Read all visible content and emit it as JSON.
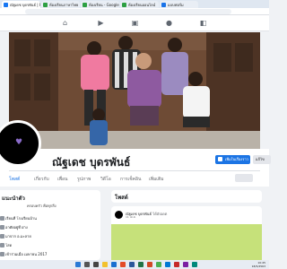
{
  "browser": {
    "tabs": [
      {
        "label": "ณัฐเดช บุดรพันธ์ | Facebook",
        "color": "#1877f2",
        "active": true
      },
      {
        "label": "ห้องเรียนภาษาไทย",
        "color": "#2ea043",
        "active": false
      },
      {
        "label": "ห้องเรียน - Google Docs",
        "color": "#2ea043",
        "active": false
      },
      {
        "label": "ห้องเรียนออนไลน์",
        "color": "#2ea043",
        "active": false
      },
      {
        "label": "แบบฟอร์ม",
        "color": "#1a73e8",
        "active": false
      }
    ]
  },
  "profile": {
    "name": "ณัฐเดช บุดรพันธ์",
    "add_story_label": "เพิ่มในเรื่องราว",
    "edit_label": "แก้ไข"
  },
  "profile_tabs": [
    "โพสต์",
    "เกี่ยวกับ",
    "เพื่อน",
    "รูปภาพ",
    "วิดีโอ",
    "การเช็คอิน",
    "เพิ่มเติม"
  ],
  "intro": {
    "title": "แนะนำตัว",
    "bio": "ครอบครัว คือทุกสิ่ง",
    "rows": [
      "เรียนที่ โรงเรียนบ้าน",
      "อาศัยอยู่ที่ ฝาง",
      "มาจาก อ.มะลาย",
      "โสด",
      "เข้าร่วมเมื่อ เมษายน 2017"
    ]
  },
  "posts": {
    "title": "โพสต์",
    "author": "ณัฐเดช บุดรพันธ์",
    "author_suffix": "ได้อัปเดต",
    "time": "11 เม.ย."
  },
  "taskbar": {
    "time": "10:45",
    "date": "18/5/2563"
  }
}
